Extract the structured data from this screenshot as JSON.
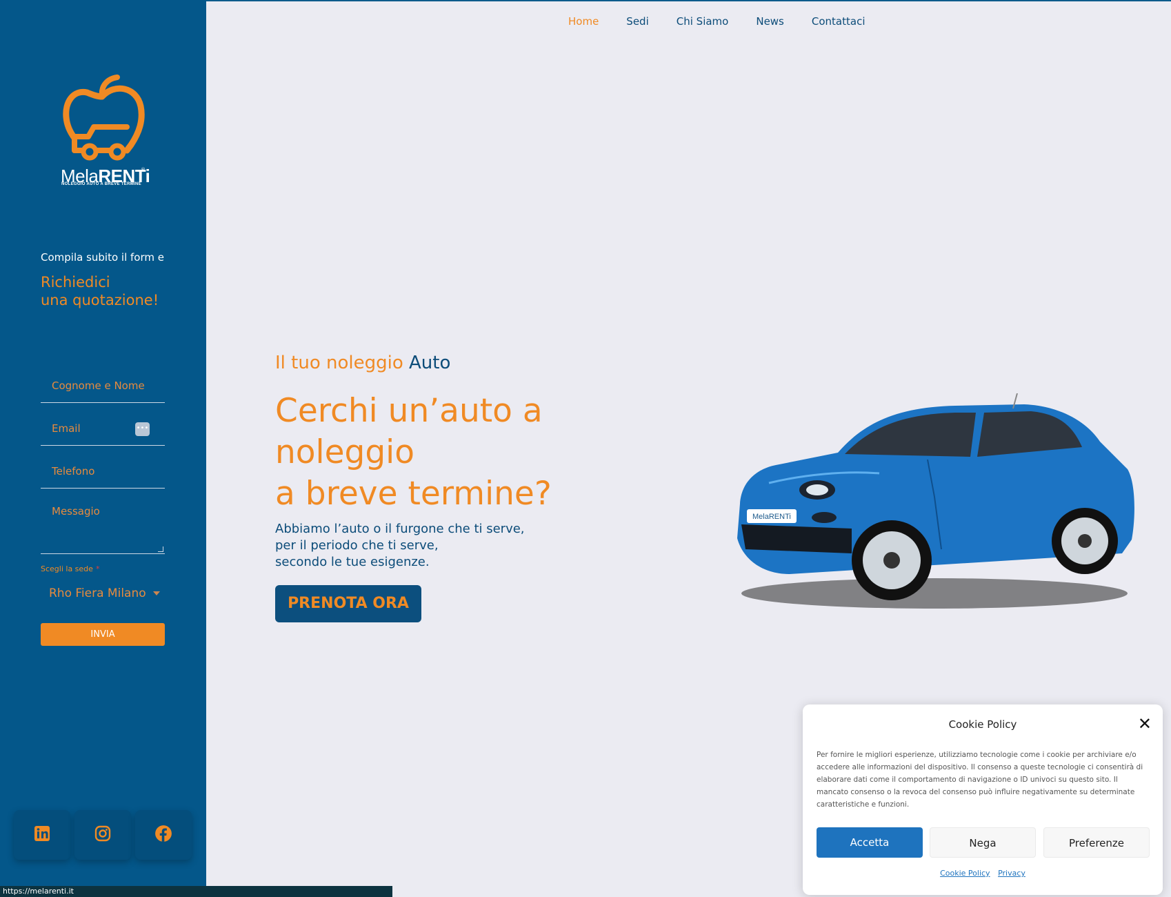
{
  "nav": {
    "items": [
      {
        "label": "Home",
        "active": true
      },
      {
        "label": "Sedi",
        "active": false
      },
      {
        "label": "Chi Siamo",
        "active": false
      },
      {
        "label": "News",
        "active": false
      },
      {
        "label": "Contattaci",
        "active": false
      }
    ]
  },
  "sidebar": {
    "logo": {
      "brand_light": "Mela",
      "brand_bold": "RENTi",
      "reg": "®",
      "tagline": "NOLEGGIO AUTO A BREVE TERMINE"
    },
    "intro": "Compila subito il form e",
    "headline_line1": "Richiedici",
    "headline_line2": "una quotazione!",
    "form": {
      "name_placeholder": "Cognome e Nome",
      "email_placeholder": "Email",
      "phone_placeholder": "Telefono",
      "message_placeholder": "Messagio",
      "sede_label": "Scegli la sede",
      "required_mark": "*",
      "sede_selected": "Rho Fiera Milano",
      "submit_label": "INVIA"
    },
    "social": [
      {
        "icon": "linkedin-icon"
      },
      {
        "icon": "instagram-icon"
      },
      {
        "icon": "facebook-icon"
      }
    ]
  },
  "hero": {
    "subtitle_orange": "Il tuo noleggio",
    "subtitle_blue": "Auto",
    "title_line1": "Cerchi un’auto a",
    "title_line2": "noleggio",
    "title_line3": "a breve termine?",
    "desc_line1": "Abbiamo l’auto o il furgone che ti serve,",
    "desc_line2": "per il periodo che ti serve,",
    "desc_line3": "secondo le tue esigenze.",
    "cta_label": "PRENOTA ORA",
    "car_badge": "MelaRENTi"
  },
  "cookie": {
    "title": "Cookie Policy",
    "close": "✕",
    "body": "Per fornire le migliori esperienze, utilizziamo tecnologie come i cookie per archiviare e/o accedere alle informazioni del dispositivo. Il consenso a queste tecnologie ci consentirà di elaborare dati come il comportamento di navigazione o ID univoci su questo sito. Il mancato consenso o la revoca del consenso può influire negativamente su determinate caratteristiche e funzioni.",
    "accept": "Accetta",
    "deny": "Nega",
    "prefs": "Preferenze",
    "link_cookie": "Cookie Policy",
    "link_privacy": "Privacy"
  },
  "statusbar": {
    "url": "https://melarenti.it"
  },
  "colors": {
    "sidebar": "#04578a",
    "accent": "#f08a24",
    "navy": "#0c4c79",
    "background": "#ebebf2",
    "accept": "#1e73be"
  }
}
